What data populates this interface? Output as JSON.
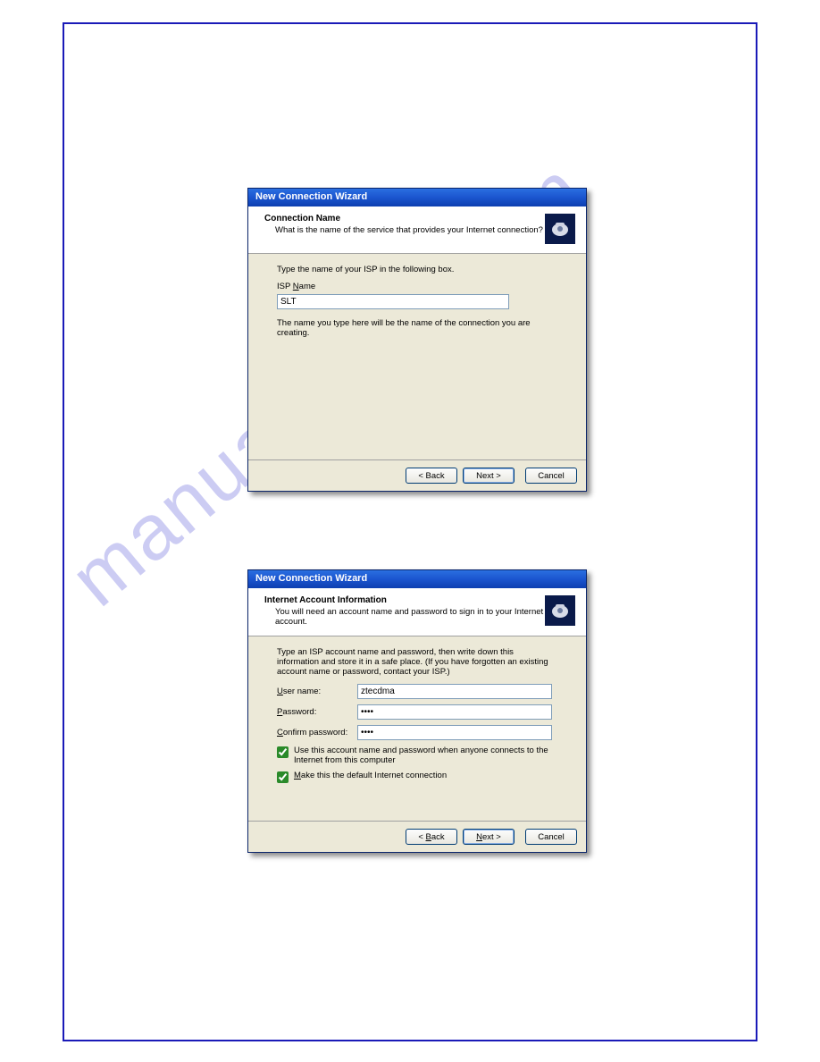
{
  "watermark": "manualshive.com",
  "dialog1": {
    "title": "New Connection Wizard",
    "header_title": "Connection Name",
    "header_sub": "What is the name of the service that provides your Internet connection?",
    "body_prompt": "Type the name of your ISP in the following box.",
    "field_label_prefix": "ISP ",
    "field_label_letter": "N",
    "field_label_suffix": "ame",
    "field_value": "SLT",
    "hint": "The name you type here will be the name of the connection you are creating.",
    "back": "< Back",
    "next": "Next >",
    "cancel": "Cancel"
  },
  "dialog2": {
    "title": "New Connection Wizard",
    "header_title": "Internet Account Information",
    "header_sub": "You will need an account name and password to sign in to your Internet account.",
    "body_prompt": "Type an ISP account name and password, then write down this information and store it in a safe place. (If you have forgotten an existing account name or password, contact your ISP.)",
    "username_label_letter": "U",
    "username_label_suffix": "ser name:",
    "username_value": "ztecdma",
    "password_label_letter": "P",
    "password_label_suffix": "assword:",
    "password_value": "••••",
    "confirm_label_letter": "C",
    "confirm_label_suffix": "onfirm password:",
    "confirm_value": "••••",
    "chk1_prefix": "Use this account name and password when anyone connects to the Internet from this computer",
    "chk2_letter": "M",
    "chk2_suffix": "ake this the default Internet connection",
    "back_letter": "B",
    "back_prefix": "< ",
    "back_suffix": "ack",
    "next_letter": "N",
    "next_suffix": "ext >",
    "cancel": "Cancel"
  }
}
